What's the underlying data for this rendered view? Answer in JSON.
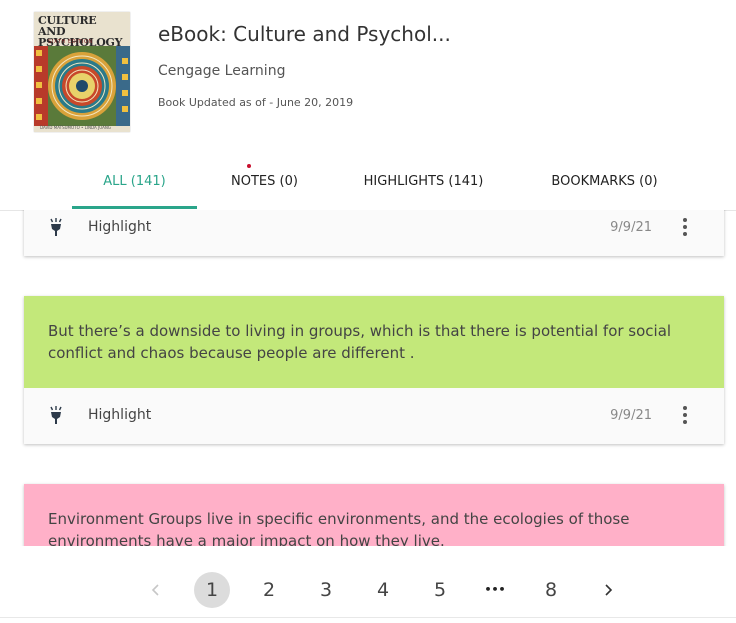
{
  "book": {
    "cover_title_line1": "CULTURE AND",
    "cover_title_line2": "PSYCHOLOGY",
    "cover_edition": "SIXTH EDITION",
    "cover_authors": "DAVID MATSUMOTO • LINDA JUANG",
    "title": "eBook: Culture and Psychol...",
    "publisher": "Cengage Learning",
    "updated": "Book Updated as of - June 20, 2019"
  },
  "tabs": [
    {
      "label": "ALL  (141)",
      "active": true
    },
    {
      "label": "NOTES  (0)",
      "active": false
    },
    {
      "label": "HIGHLIGHTS  (141)",
      "active": false
    },
    {
      "label": "BOOKMARKS  (0)",
      "active": false
    }
  ],
  "cards": [
    {
      "text": "",
      "color": "#ffffff",
      "type": "Highlight",
      "date": "9/9/21"
    },
    {
      "text": "But there’s a downside to living in groups, which is that there is potential for social conflict and chaos because people are different .",
      "color": "#c3e87a",
      "type": "Highlight",
      "date": "9/9/21"
    },
    {
      "text": "Environment Groups live in specific environments, and the ecologies of those environments have a major impact on how they live.",
      "color": "#ffb0c8",
      "type": "",
      "date": ""
    }
  ],
  "pagination": {
    "prev": "‹",
    "pages": [
      "1",
      "2",
      "3",
      "4",
      "5",
      "•••",
      "8"
    ],
    "current": "1",
    "next": "›"
  },
  "colors": {
    "accent": "#2aa58a",
    "highlight_green": "#c3e87a",
    "highlight_pink": "#ffb0c8",
    "notification_dot": "#c8102e"
  },
  "icons": {
    "highlight": "highlighter-icon",
    "menu": "more-vertical-icon",
    "prev": "chevron-left-icon",
    "next": "chevron-right-icon"
  }
}
